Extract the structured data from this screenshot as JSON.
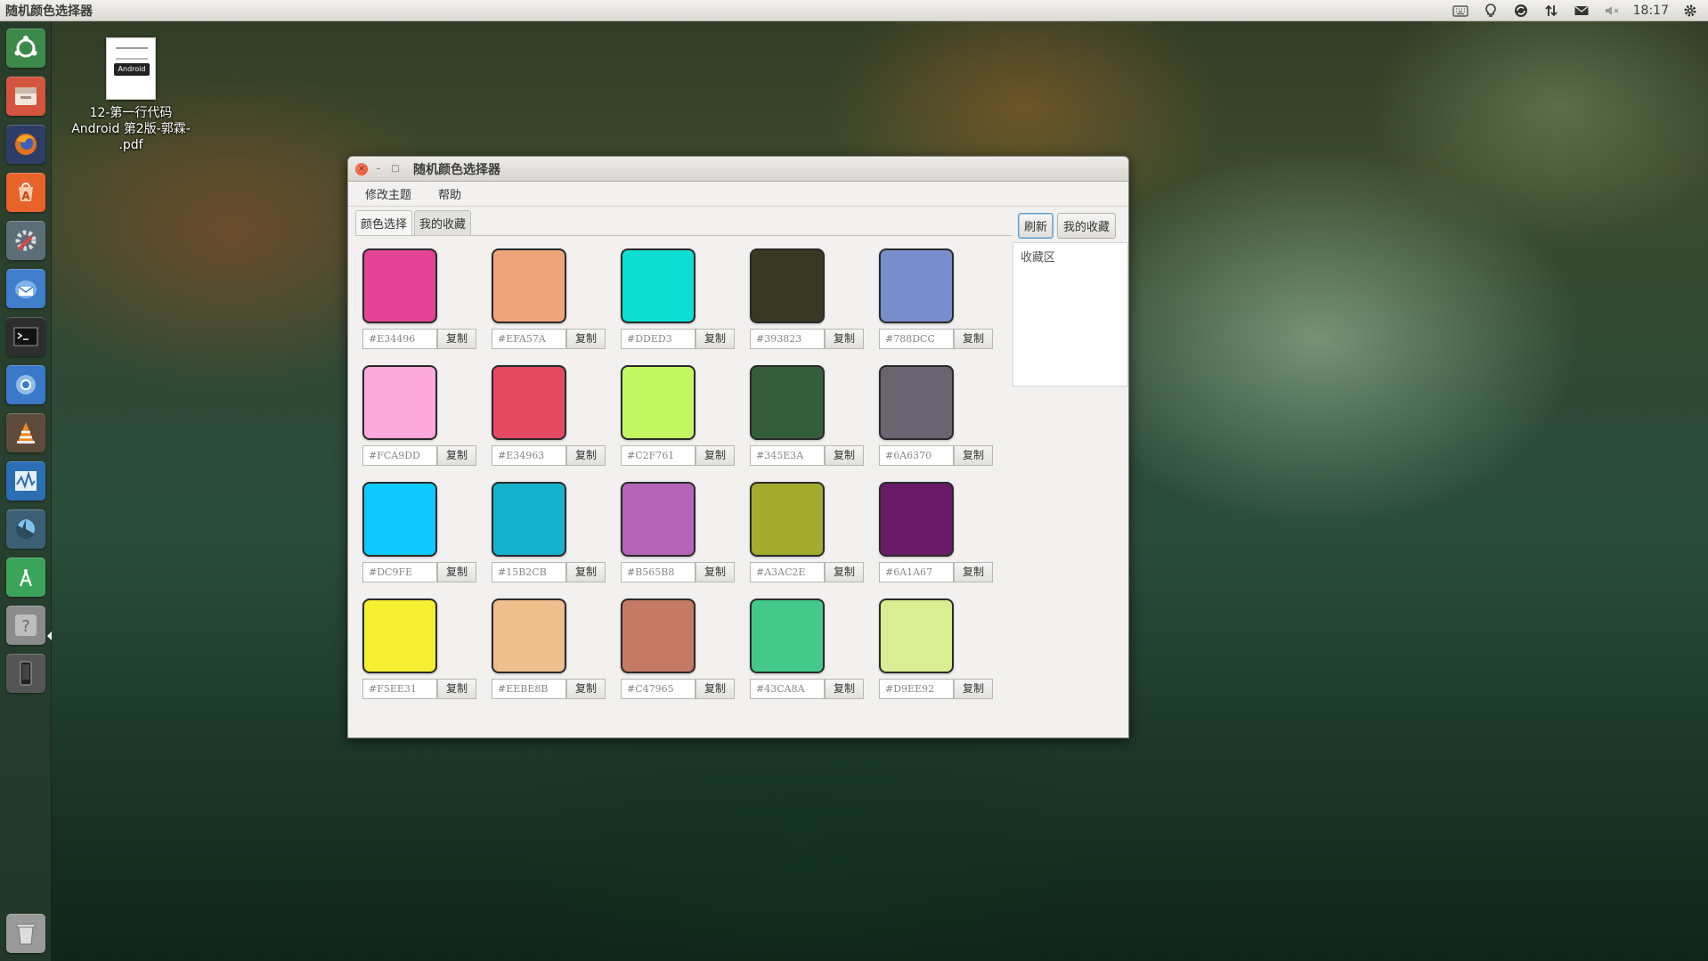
{
  "topbar": {
    "active_app_title": "随机颜色选择器",
    "clock": "18:17",
    "indicators": [
      "keyboard-icon",
      "bulb-icon",
      "sync-icon",
      "network-icon",
      "mail-icon",
      "volume-muted-icon",
      "settings-gear-icon"
    ]
  },
  "launcher": {
    "items": [
      {
        "icon": "ubuntu-dash-icon",
        "color": "#3b8a4a"
      },
      {
        "icon": "files-icon",
        "color": "#d4543d"
      },
      {
        "icon": "firefox-icon",
        "color": "#e2711d"
      },
      {
        "icon": "software-center-icon",
        "color": "#e8622a"
      },
      {
        "icon": "system-settings-icon",
        "color": "#5b6e77"
      },
      {
        "icon": "thunderbird-icon",
        "color": "#3f7ecb"
      },
      {
        "icon": "terminal-icon",
        "color": "#2e2e2e"
      },
      {
        "icon": "chromium-icon",
        "color": "#3a78c8"
      },
      {
        "icon": "vlc-icon",
        "color": "#d46a1f"
      },
      {
        "icon": "system-monitor-icon",
        "color": "#2a6fb3"
      },
      {
        "icon": "shotwell-icon",
        "color": "#3b7fb4"
      },
      {
        "icon": "android-studio-icon",
        "color": "#3aa55a"
      },
      {
        "icon": "help-icon",
        "color": "#8b8b8b"
      },
      {
        "icon": "phone-device-icon",
        "color": "#555555"
      },
      {
        "icon": "trash-icon",
        "color": "#9a9a9a"
      }
    ]
  },
  "desktop": {
    "file": {
      "label_lines": [
        "12-第一行代码",
        "Android 第2版-郭霖-",
        ".pdf"
      ],
      "thumb_text": "Android"
    }
  },
  "window": {
    "title": "随机颜色选择器",
    "menu": [
      "修改主题",
      "帮助"
    ],
    "tabs": [
      "颜色选择",
      "我的收藏"
    ],
    "active_tab": 0,
    "copy_label": "复制",
    "colors": [
      [
        "#E34496",
        "#EFA57A",
        "#DDED3",
        "#393823",
        "#788DCC"
      ],
      [
        "#FCA9DD",
        "#E34963",
        "#C2F761",
        "#345E3A",
        "#6A6370"
      ],
      [
        "#DC9FE",
        "#15B2CB",
        "#B565B8",
        "#A3AC2E",
        "#6A1A67"
      ],
      [
        "#F5EE31",
        "#EEBE8B",
        "#C47965",
        "#43CA8A",
        "#D9EE92"
      ]
    ],
    "swatch_fill": [
      [
        "#E34496",
        "#EFA57A",
        "#0DDED3",
        "#393823",
        "#788DCC"
      ],
      [
        "#FCA9DD",
        "#E34963",
        "#C2F761",
        "#345E3A",
        "#6A6370"
      ],
      [
        "#0DC9FE",
        "#15B2CB",
        "#B565B8",
        "#A3AC2E",
        "#6A1A67"
      ],
      [
        "#F5EE31",
        "#EEBE8B",
        "#C47965",
        "#43CA8A",
        "#D9EE92"
      ]
    ],
    "right_buttons": {
      "refresh": "刷新",
      "favorites": "我的收藏"
    },
    "favorites_area_label": "收藏区"
  }
}
